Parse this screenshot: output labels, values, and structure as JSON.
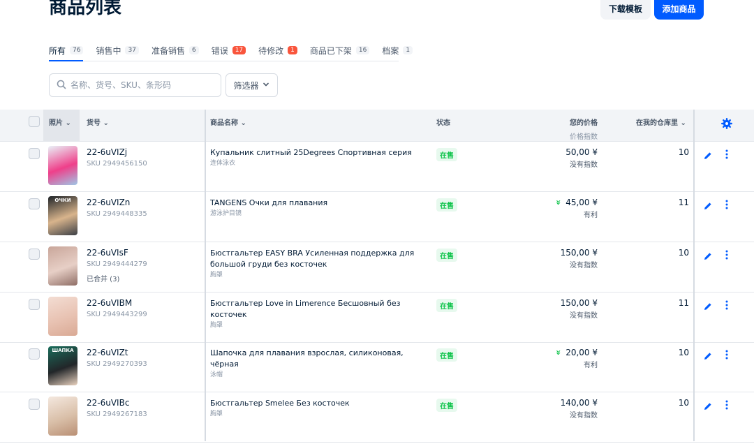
{
  "header": {
    "title": "商品列表",
    "download_label": "下载模板",
    "add_label": "添加商品"
  },
  "tabs": [
    {
      "label": "所有",
      "count": "76",
      "active": true
    },
    {
      "label": "销售中",
      "count": "37"
    },
    {
      "label": "准备销售",
      "count": "6"
    },
    {
      "label": "错误",
      "count": "17",
      "alert": true
    },
    {
      "label": "待修改",
      "count": "1",
      "alert": true
    },
    {
      "label": "商品已下架",
      "count": "16"
    },
    {
      "label": "档案",
      "count": "1"
    }
  ],
  "search": {
    "placeholder": "名称、货号、SKU、条形码"
  },
  "filter": {
    "label": "筛选器"
  },
  "columns": {
    "photo": "照片",
    "code": "货号",
    "name": "商品名称",
    "status": "状态",
    "price": "您的价格",
    "price_sub": "价格指数",
    "stock": "在我的仓库里"
  },
  "rows": [
    {
      "code": "22-6uVIZj",
      "sku": "SKU 2949456150",
      "merged": "",
      "name": "Купальник слитный 25Degrees Спортивная серия",
      "category": "连体泳衣",
      "status": "在售",
      "price": "50,00 ¥",
      "price_index": "没有指数",
      "price_arrow": "",
      "stock": "10",
      "thumb_colors": [
        "#e9f2f8",
        "#ef3f8a",
        "#9fc6e6"
      ]
    },
    {
      "code": "22-6uVIZn",
      "sku": "SKU 2949448335",
      "merged": "",
      "name": "TANGENS Очки для плавания",
      "category": "游泳护目镜",
      "status": "在售",
      "price": "45,00 ¥",
      "price_index": "有利",
      "price_arrow": "»",
      "stock": "11",
      "thumb_colors": [
        "#1e2328",
        "#d8b48c",
        "#3b3f45"
      ],
      "thumb_text": "ОЧКИ"
    },
    {
      "code": "22-6uVIsF",
      "sku": "SKU 2949444279",
      "merged": "已合并 (3)",
      "name": "Бюстгальтер EASY BRA Усиленная поддержка для большой груди без косточек",
      "category": "胸罩",
      "status": "在售",
      "price": "150,00 ¥",
      "price_index": "没有指数",
      "price_arrow": "",
      "stock": "10",
      "thumb_colors": [
        "#c9a69a",
        "#e7cfc6",
        "#8f6e66"
      ]
    },
    {
      "code": "22-6uVIBM",
      "sku": "SKU 2949443299",
      "merged": "",
      "name": "Бюстгальтер Love in Limerence Бесшовный без косточек",
      "category": "胸罩",
      "status": "在售",
      "price": "150,00 ¥",
      "price_index": "没有指数",
      "price_arrow": "",
      "stock": "11",
      "thumb_colors": [
        "#f3ddd3",
        "#e8c2b2",
        "#d9a994"
      ]
    },
    {
      "code": "22-6uVIZt",
      "sku": "SKU 2949270393",
      "merged": "",
      "name": "Шапочка для плавания взрослая, силиконовая, чёрная",
      "category": "泳帽",
      "status": "在售",
      "price": "20,00 ¥",
      "price_index": "有利",
      "price_arrow": "»",
      "stock": "10",
      "thumb_colors": [
        "#1a6e5c",
        "#222629",
        "#e9d2bf"
      ],
      "thumb_text": "ШАПКА"
    },
    {
      "code": "22-6uVIBc",
      "sku": "SKU 2949267183",
      "merged": "",
      "name": "Бюстгальтер Smelee Без косточек",
      "category": "胸罩",
      "status": "在售",
      "price": "140,00 ¥",
      "price_index": "没有指数",
      "price_arrow": "",
      "stock": "10",
      "thumb_colors": [
        "#f4e8df",
        "#d9bfa8",
        "#b98f74"
      ]
    }
  ],
  "colors": {
    "accent": "#005bff",
    "status_green": "#10c44c",
    "alert_red": "#f9553c",
    "favorable_green": "#10c44c"
  }
}
